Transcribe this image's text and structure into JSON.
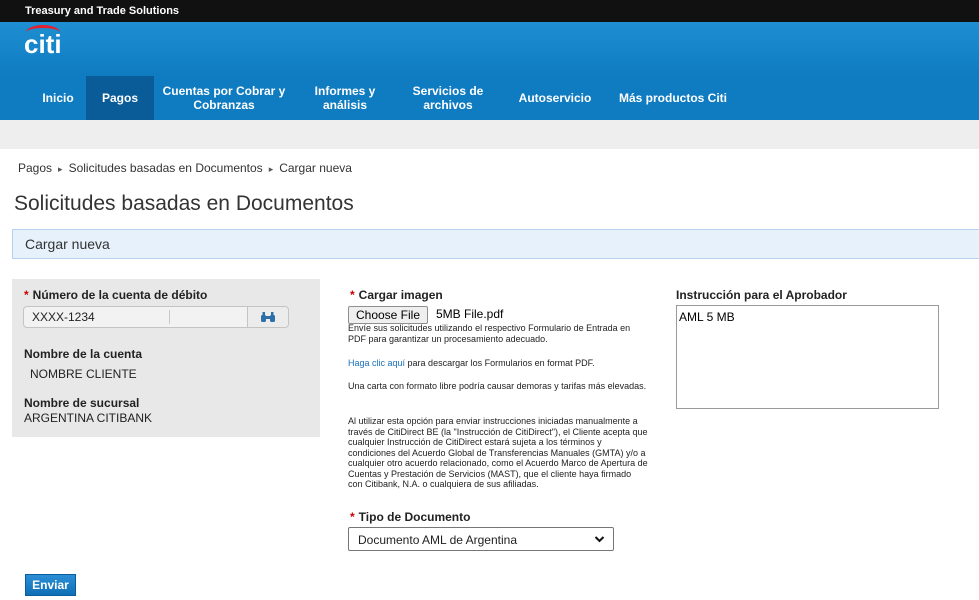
{
  "topbar": {
    "title": "Treasury and Trade Solutions"
  },
  "brand": {
    "logo_text": "citi",
    "logo_color": "#e5202e"
  },
  "nav": {
    "items": [
      {
        "label": "Inicio"
      },
      {
        "label": "Pagos"
      },
      {
        "label": "Cuentas por Cobrar y Cobranzas"
      },
      {
        "label": "Informes y análisis"
      },
      {
        "label": "Servicios de archivos"
      },
      {
        "label": "Autoservicio"
      },
      {
        "label": "Más productos Citi"
      }
    ]
  },
  "breadcrumb": {
    "items": [
      "Pagos",
      "Solicitudes basadas en Documentos",
      "Cargar nueva"
    ],
    "separator": "▸"
  },
  "page": {
    "title": "Solicitudes basadas en Documentos"
  },
  "panel": {
    "header": "Cargar nueva"
  },
  "account": {
    "required_mark": "*",
    "label": "Número de la cuenta de débito",
    "value": "XXXX-1234",
    "name_label": "Nombre de la cuenta",
    "name_value": "NOMBRE CLIENTE",
    "branch_label": "Nombre de sucursal",
    "branch_value": "ARGENTINA CITIBANK"
  },
  "upload": {
    "required_mark": "*",
    "label": "Cargar imagen",
    "button_label": "Choose File",
    "file_name": "5MB File.pdf",
    "help1": "Envíe sus solicitudes utilizando el respectivo Formulario de Entrada en PDF para garantizar un procesamiento adecuado.",
    "help2_link": "Haga clic aquí",
    "help2_rest": " para descargar los Formularios en format PDF.",
    "help3": "Una carta con formato libre podría causar demoras y tarifas más elevadas.",
    "help4": "Al utilizar esta opción para enviar instrucciones iniciadas manualmente a través de CitiDirect BE (la \"Instrucción de CitiDirect\"), el Cliente acepta que cualquier Instrucción de CitiDirect estará sujeta a los términos y condiciones del Acuerdo Global de Transferencias Manuales (GMTA) y/o a cualquier otro acuerdo relacionado, como el Acuerdo Marco de Apertura de Cuentas y Prestación de Servicios (MAST), que el cliente haya firmado con Citibank, N.A. o cualquiera de sus afiliadas."
  },
  "doc_type": {
    "required_mark": "*",
    "label": "Tipo de Documento",
    "selected": "Documento AML de Argentina"
  },
  "approver": {
    "label": "Instrucción para el Aprobador",
    "value": "AML 5 MB"
  },
  "actions": {
    "submit_label": "Enviar"
  },
  "colors": {
    "nav_blue": "#0f7bc0",
    "nav_active": "#0a5c99",
    "required_red": "#cc0000",
    "link_blue": "#1a6fb8"
  }
}
